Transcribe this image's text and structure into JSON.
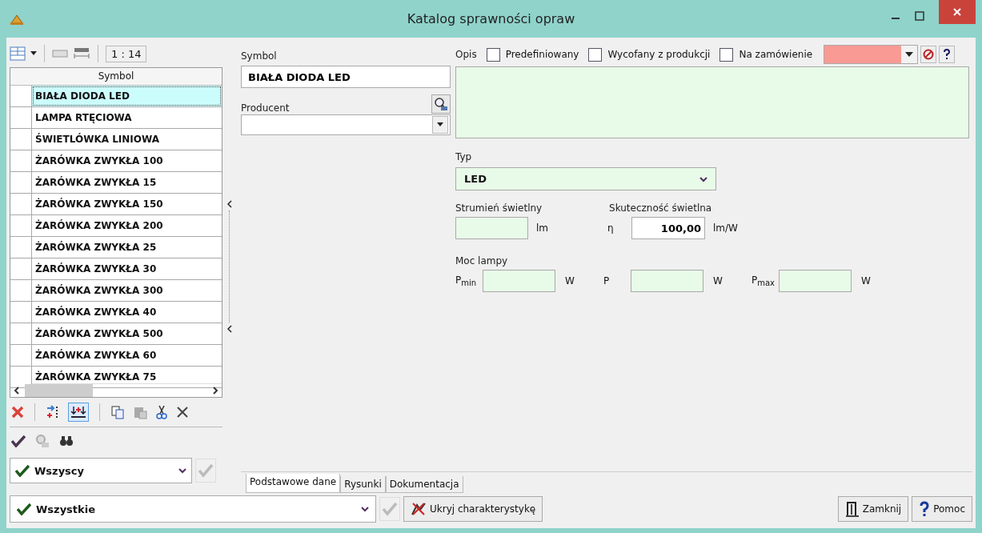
{
  "window": {
    "title": "Katalog sprawności opraw"
  },
  "list_toolbar": {
    "scale": "1 : 14"
  },
  "list": {
    "header": "Symbol",
    "rows": [
      {
        "text": "BIAŁA DIODA LED",
        "selected": true
      },
      {
        "text": "LAMPA RTĘCIOWA",
        "selected": false
      },
      {
        "text": "ŚWIETLÓWKA LINIOWA",
        "selected": false
      },
      {
        "text": "ŻARÓWKA ZWYKŁA 100",
        "selected": false
      },
      {
        "text": "ŻARÓWKA ZWYKŁA 15",
        "selected": false
      },
      {
        "text": "ŻARÓWKA ZWYKŁA 150",
        "selected": false
      },
      {
        "text": "ŻARÓWKA ZWYKŁA 200",
        "selected": false
      },
      {
        "text": "ŻARÓWKA ZWYKŁA 25",
        "selected": false
      },
      {
        "text": "ŻARÓWKA ZWYKŁA 30",
        "selected": false
      },
      {
        "text": "ŻARÓWKA ZWYKŁA 300",
        "selected": false
      },
      {
        "text": "ŻARÓWKA ZWYKŁA 40",
        "selected": false
      },
      {
        "text": "ŻARÓWKA ZWYKŁA 500",
        "selected": false
      },
      {
        "text": "ŻARÓWKA ZWYKŁA 60",
        "selected": false
      },
      {
        "text": "ŻARÓWKA ZWYKŁA 75",
        "selected": false
      }
    ]
  },
  "form": {
    "symbol": {
      "label": "Symbol",
      "value": "BIAŁA DIODA LED"
    },
    "producent": {
      "label": "Producent"
    },
    "opis": {
      "label": "Opis"
    },
    "checkboxes": [
      {
        "label": "Predefiniowany",
        "checked": false
      },
      {
        "label": "Wycofany z produkcji",
        "checked": false
      },
      {
        "label": "Na zamówienie",
        "checked": false
      }
    ],
    "color_picker": {
      "color": "#f99a94"
    },
    "typ": {
      "label": "Typ",
      "value": "LED"
    },
    "strumien": {
      "label": "Strumień świetlny",
      "unit": "lm"
    },
    "skutecznosc": {
      "label": "Skuteczność świetlna",
      "prefix": "η",
      "value": "100,00",
      "unit": "lm/W"
    },
    "moc": {
      "label": "Moc lampy",
      "fields": [
        {
          "label": "P$_{min}$",
          "unit": "W"
        },
        {
          "label": "P",
          "unit": "W"
        },
        {
          "label": "P$_{max}$",
          "unit": "W"
        }
      ]
    }
  },
  "filters": [
    {
      "value": "Wszyscy"
    },
    {
      "value": "Wszystkie"
    }
  ],
  "tabs": [
    {
      "label": "Podstawowe dane",
      "selected": true
    },
    {
      "label": "Rysunki",
      "selected": false
    },
    {
      "label": "Dokumentacja",
      "selected": false
    }
  ],
  "buttons": [
    {
      "label": "Ukryj charakterystykę"
    },
    {
      "label": "Zamknij"
    },
    {
      "label": "Pomoc"
    }
  ]
}
